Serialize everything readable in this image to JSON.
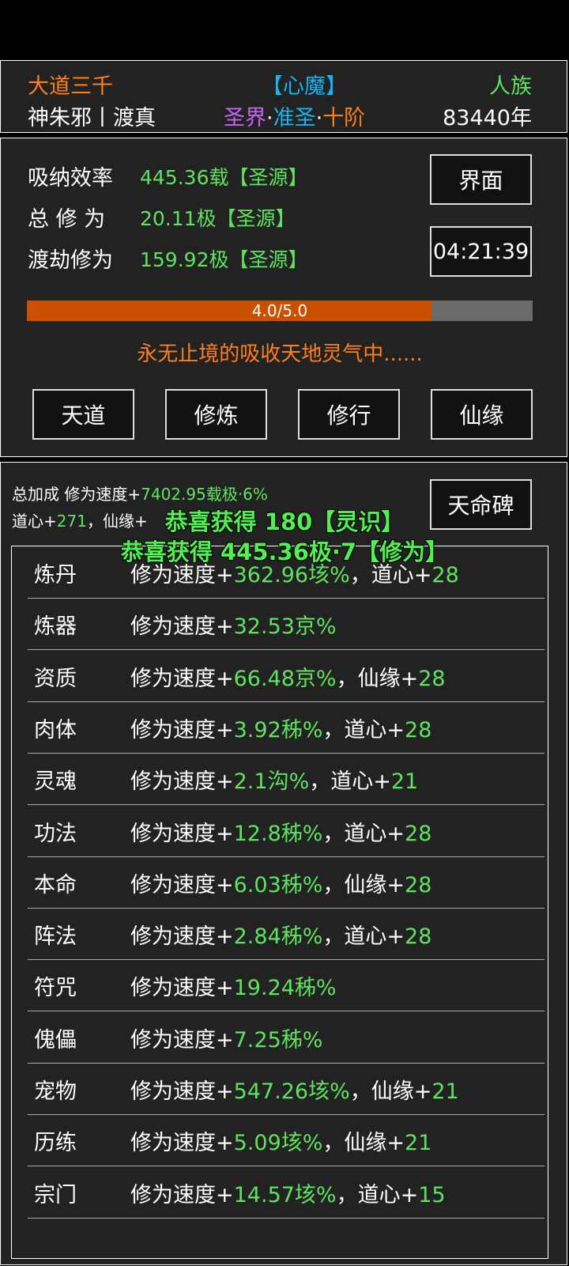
{
  "colors": {
    "orange": "#ff7f1a",
    "cyan": "#18b4f0",
    "purple": "#c763f5",
    "green": "#5fe35f",
    "progress_fill": "#c85000",
    "progress_bg": "#6a6a6a"
  },
  "header": {
    "dao": "大道三千",
    "state": "【心魔】",
    "race": "人族",
    "name": "神朱邪丨渡真",
    "realm_a": "圣界",
    "realm_b": "准圣",
    "realm_c": "十阶",
    "sep": "·",
    "age": "83440年"
  },
  "stats": {
    "absorb_label": "吸纳效率",
    "absorb_value": "445.36载【圣源】",
    "total_label": "总 修 为",
    "total_value": "20.11极【圣源】",
    "tribulation_label": "渡劫修为",
    "tribulation_value": "159.92极【圣源】",
    "interface_button": "界面",
    "timer": "04:21:39",
    "progress_text": "4.0/5.0",
    "progress_fraction": 0.8,
    "status_message": "永无止境的吸收天地灵气中......"
  },
  "nav": {
    "tiandao": "天道",
    "xiulian": "修炼",
    "xiuxing": "修行",
    "xianyuan": "仙缘"
  },
  "bonus": {
    "line1_prefix": "总加成 修为速度+",
    "line1_value": "7402.95载极·6%",
    "line2_prefix": "道心+",
    "line2_value": "271",
    "line2_mid": "，仙缘+",
    "tianming_button": "天命碑"
  },
  "notices": {
    "first": "恭喜获得 180【灵识】",
    "second": "恭喜获得 445.36极·7【修为】"
  },
  "speed_prefix": "修为速度+",
  "rows": [
    {
      "name": "炼丹",
      "value": "362.96垓%",
      "extra_label": "，道心+",
      "extra_value": "28"
    },
    {
      "name": "炼器",
      "value": "32.53京%",
      "extra_label": "",
      "extra_value": ""
    },
    {
      "name": "资质",
      "value": "66.48京%",
      "extra_label": "，仙缘+",
      "extra_value": "28"
    },
    {
      "name": "肉体",
      "value": "3.92秭%",
      "extra_label": "，道心+",
      "extra_value": "28"
    },
    {
      "name": "灵魂",
      "value": "2.1沟%",
      "extra_label": "，道心+",
      "extra_value": "21"
    },
    {
      "name": "功法",
      "value": "12.8秭%",
      "extra_label": "，道心+",
      "extra_value": "28"
    },
    {
      "name": "本命",
      "value": "6.03秭%",
      "extra_label": "，仙缘+",
      "extra_value": "28"
    },
    {
      "name": "阵法",
      "value": "2.84秭%",
      "extra_label": "，道心+",
      "extra_value": "28"
    },
    {
      "name": "符咒",
      "value": "19.24秭%",
      "extra_label": "",
      "extra_value": ""
    },
    {
      "name": "傀儡",
      "value": "7.25秭%",
      "extra_label": "",
      "extra_value": ""
    },
    {
      "name": "宠物",
      "value": "547.26垓%",
      "extra_label": "，仙缘+",
      "extra_value": "21"
    },
    {
      "name": "历练",
      "value": "5.09垓%",
      "extra_label": "，仙缘+",
      "extra_value": "21"
    },
    {
      "name": "宗门",
      "value": "14.57垓%",
      "extra_label": "，道心+",
      "extra_value": "15"
    }
  ]
}
